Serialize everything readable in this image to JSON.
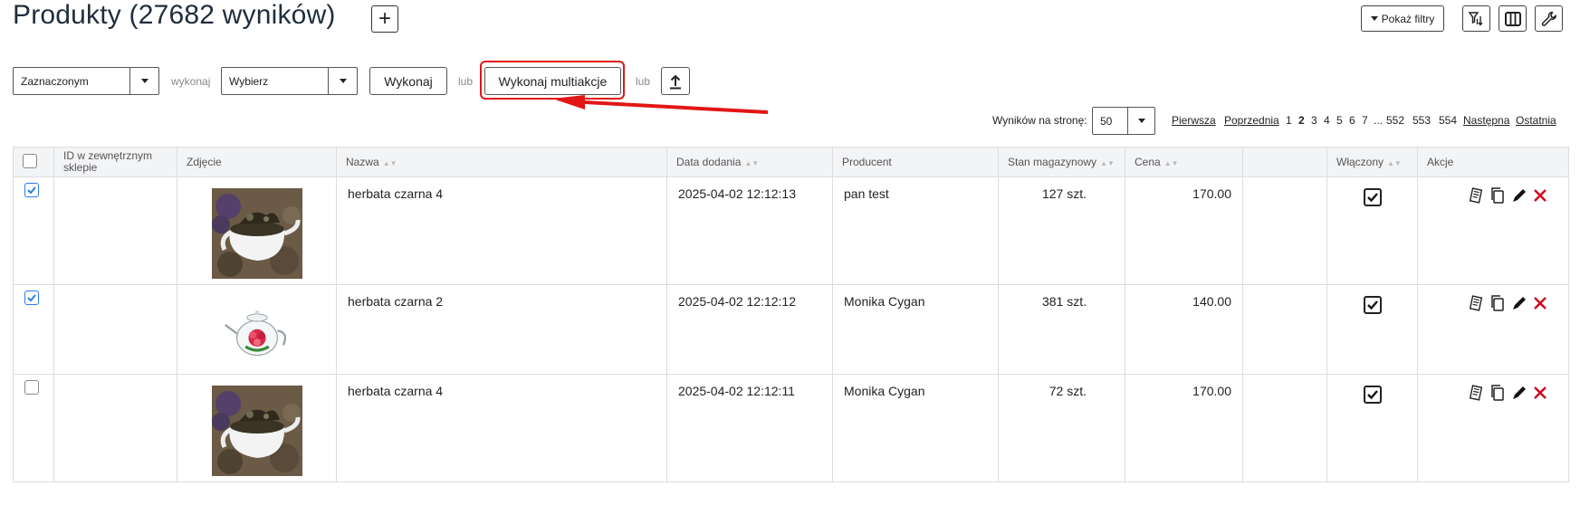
{
  "header": {
    "title": "Produkty (27682 wyników)",
    "add_label": "+",
    "show_filters_label": "Pokaż filtry",
    "filter_sort_icon": "filter-sort-icon",
    "columns_icon": "columns-icon",
    "wrench_icon": "wrench-icon"
  },
  "actions_bar": {
    "scope_select_value": "Zaznaczonym",
    "execute_label": "wykonaj",
    "action_select_value": "Wybierz",
    "run_button": "Wykonaj",
    "or_label_1": "lub",
    "multi_button": "Wykonaj multiakcje",
    "or_label_2": "lub",
    "upload_icon": "upload-icon"
  },
  "pagination": {
    "per_page_label": "Wyników na stronę:",
    "per_page_value": "50",
    "first": "Pierwsza",
    "prev": "Poprzednia",
    "pages": [
      "1",
      "2",
      "3",
      "4",
      "5",
      "6",
      "7",
      "...",
      "552",
      "553",
      "554"
    ],
    "current": "2",
    "next": "Następna",
    "last": "Ostatnia"
  },
  "table": {
    "columns": {
      "external_id": "ID w zewnętrznym sklepie",
      "photo": "Zdjęcie",
      "name": "Nazwa",
      "date_added": "Data dodania",
      "producer": "Producent",
      "stock": "Stan magazynowy",
      "price": "Cena",
      "blank": "",
      "enabled": "Włączony",
      "actions": "Akcje"
    },
    "rows": [
      {
        "checked": true,
        "external_id": "",
        "photo": "teapot-with-leaves",
        "name": "herbata czarna 4",
        "date_added": "2025-04-02 12:12:13",
        "producer": "pan test",
        "stock": "127 szt.",
        "price": "170.00",
        "enabled": true
      },
      {
        "checked": true,
        "external_id": "",
        "photo": "glass-teapot-flower",
        "name": "herbata czarna 2",
        "date_added": "2025-04-02 12:12:12",
        "producer": "Monika Cygan",
        "stock": "381 szt.",
        "price": "140.00",
        "enabled": true
      },
      {
        "checked": false,
        "external_id": "",
        "photo": "teapot-with-leaves",
        "name": "herbata czarna 4",
        "date_added": "2025-04-02 12:12:11",
        "producer": "Monika Cygan",
        "stock": "72 szt.",
        "price": "170.00",
        "enabled": true
      }
    ]
  },
  "colors": {
    "highlight": "#e21616",
    "checkbox_blue": "#2b7de9",
    "delete_red": "#d0021b",
    "header_bg": "#f3f4f6"
  }
}
